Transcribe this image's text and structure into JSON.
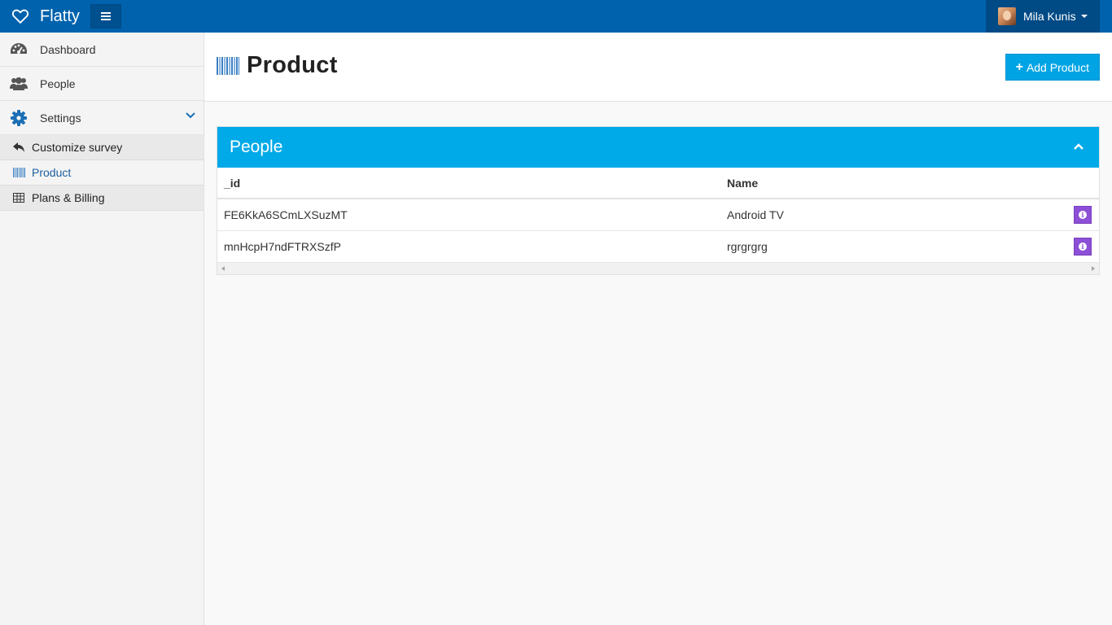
{
  "app": {
    "brand_name": "Flatty",
    "brand_icon": "heart-icon",
    "colors": {
      "topbar": "#0062ad",
      "accent": "#00a9e8",
      "info_button": "#8c4fd6"
    }
  },
  "user": {
    "name": "Mila Kunis"
  },
  "sidebar": {
    "items": [
      {
        "label": "Dashboard",
        "icon": "dashboard-icon"
      },
      {
        "label": "People",
        "icon": "users-icon"
      },
      {
        "label": "Settings",
        "icon": "gear-icon",
        "expanded": true
      }
    ],
    "subitems": [
      {
        "label": "Customize survey",
        "icon": "reply-icon"
      },
      {
        "label": "Product",
        "icon": "barcode-icon",
        "active": true
      },
      {
        "label": "Plans & Billing",
        "icon": "table-icon"
      }
    ]
  },
  "header": {
    "title": "Product",
    "add_button": "Add Product"
  },
  "panel": {
    "title": "People",
    "columns": [
      "_id",
      "Name"
    ],
    "rows": [
      {
        "id": "FE6KkA6SCmLXSuzMT",
        "name": "Android TV"
      },
      {
        "id": "mnHcpH7ndFTRXSzfP",
        "name": "rgrgrgrg"
      }
    ]
  }
}
